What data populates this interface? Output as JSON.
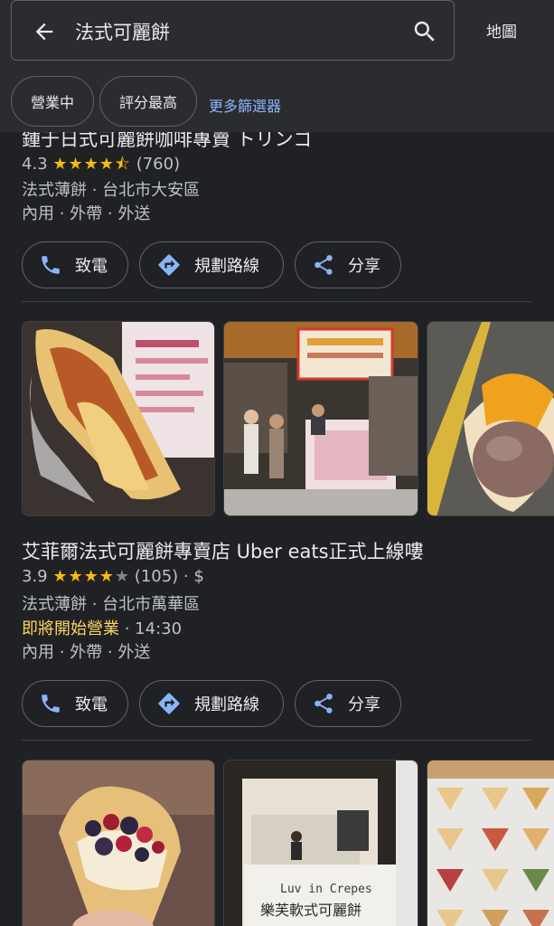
{
  "search": {
    "query": "法式可麗餅",
    "map_label": "地圖"
  },
  "filters": {
    "chip1": "營業中",
    "chip2": "評分最高",
    "more": "更多篩選器"
  },
  "result1": {
    "title": "鍾于日式可麗餅咖啡專賣 トリンゴ",
    "rating": "4.3",
    "stars": "★★★★⯪",
    "reviews": "(760)",
    "category_location": "法式薄餅 · 台北市大安區",
    "services": "內用 · 外帶 · 外送"
  },
  "result2": {
    "title": "艾菲爾法式可麗餅專賣店 Uber eats正式上線嘍",
    "rating": "3.9",
    "stars": "★★★★",
    "star_empty": "★",
    "reviews": "(105) · $",
    "category_location": "法式薄餅 · 台北市萬華區",
    "status": "即將開始營業",
    "status_time": " · 14:30",
    "services": "內用 · 外帶 · 外送",
    "photo_sign_en": "Luv in Crepes",
    "photo_sign_zh": "樂芙軟式可麗餅"
  },
  "actions": {
    "call": "致電",
    "directions": "規劃路線",
    "share": "分享"
  },
  "colors": {
    "accent_link": "#8ab4f8",
    "star": "#fbbc04",
    "open_soon": "#fdd663"
  }
}
